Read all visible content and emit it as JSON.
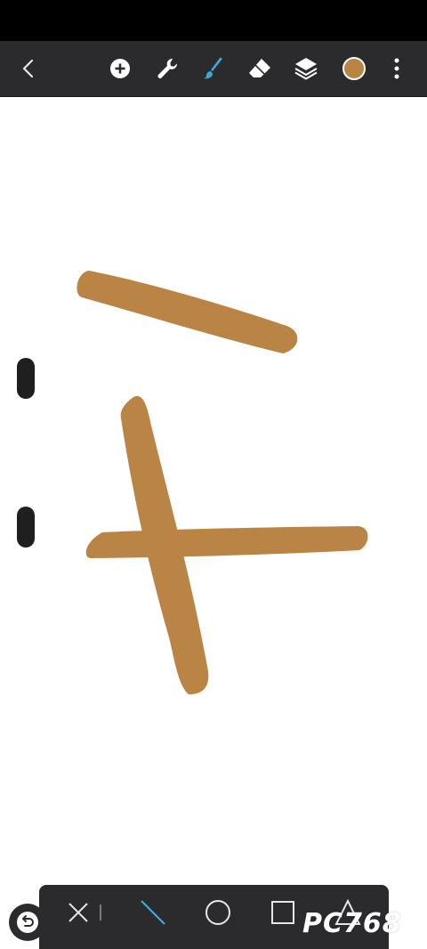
{
  "app": {
    "status_bar_color": "#000000",
    "toolbar_color": "#2b2b2d",
    "brush_color": "#ba8445",
    "active_tool_color": "#3ea7d8"
  },
  "toolbar": {
    "icons": [
      "back-icon",
      "add-icon",
      "wrench-icon",
      "brush-icon",
      "eraser-icon",
      "layers-icon",
      "color-swatch",
      "more-icon"
    ]
  },
  "shapes_bar": {
    "icons": [
      "close-icon",
      "divider",
      "line-icon",
      "ellipse-icon",
      "rectangle-icon",
      "polygon-icon"
    ],
    "active": "line-icon"
  },
  "watermark": {
    "text": "PC768"
  }
}
